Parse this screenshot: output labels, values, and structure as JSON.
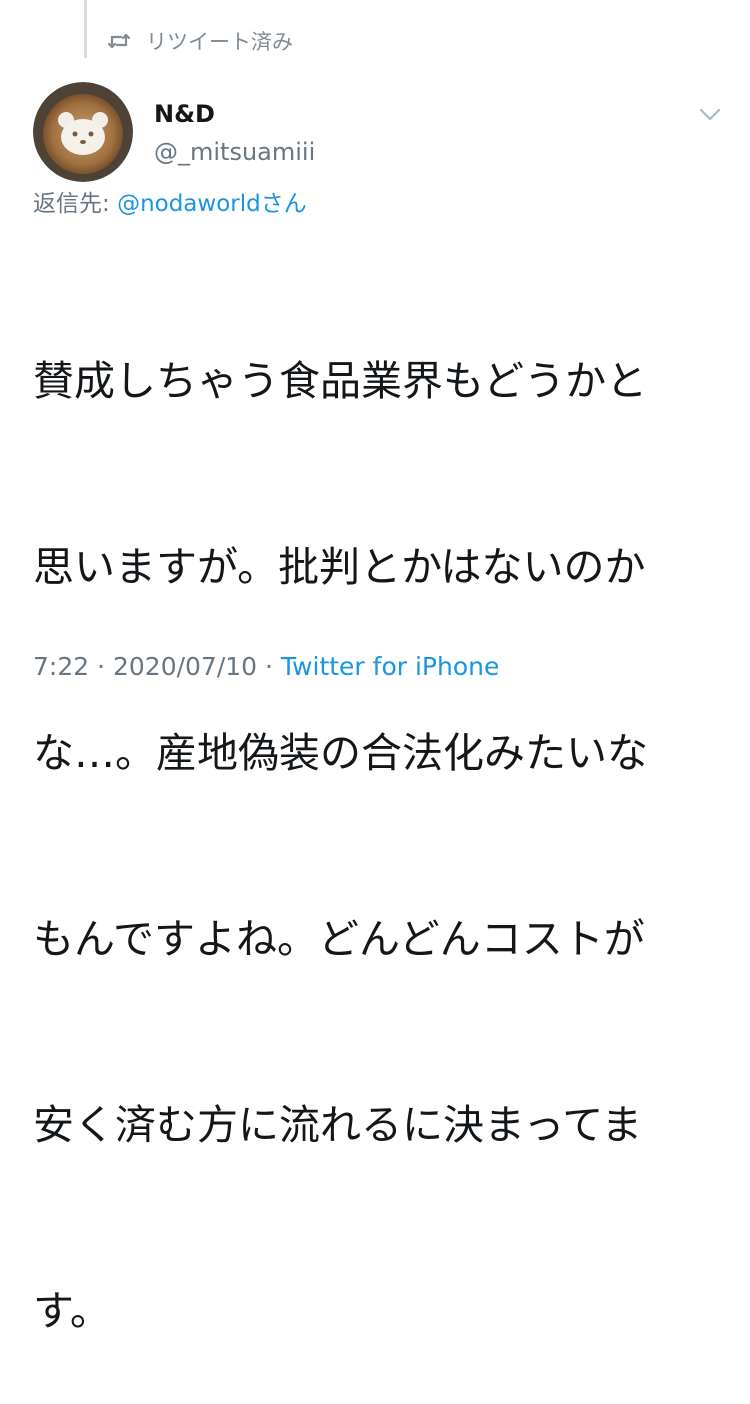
{
  "retweet": {
    "icon": "retweet-icon",
    "label": "リツイート済み"
  },
  "user": {
    "name": "N&D",
    "handle": "@_mitsuamiii",
    "avatar": "bear-latte-art-avatar"
  },
  "menu": {
    "icon": "chevron-down-icon"
  },
  "reply": {
    "prefix": "返信先:",
    "mention": "@nodaworld",
    "suffix": "さん"
  },
  "tweet": {
    "lines": [
      "賛成しちゃう食品業界もどうかと",
      "思いますが。批判とかはないのか",
      "な…。産地偽装の合法化みたいな",
      "もんですよね。どんどんコストが",
      "安く済む方に流れるに決まってま",
      "す。"
    ]
  },
  "meta": {
    "time": "7:22",
    "sep1": " · ",
    "date": "2020/07/10",
    "sep2": " · ",
    "source": "Twitter for iPhone"
  },
  "colors": {
    "link": "#1b95e0",
    "secondary": "#687682",
    "text": "#14171a"
  }
}
